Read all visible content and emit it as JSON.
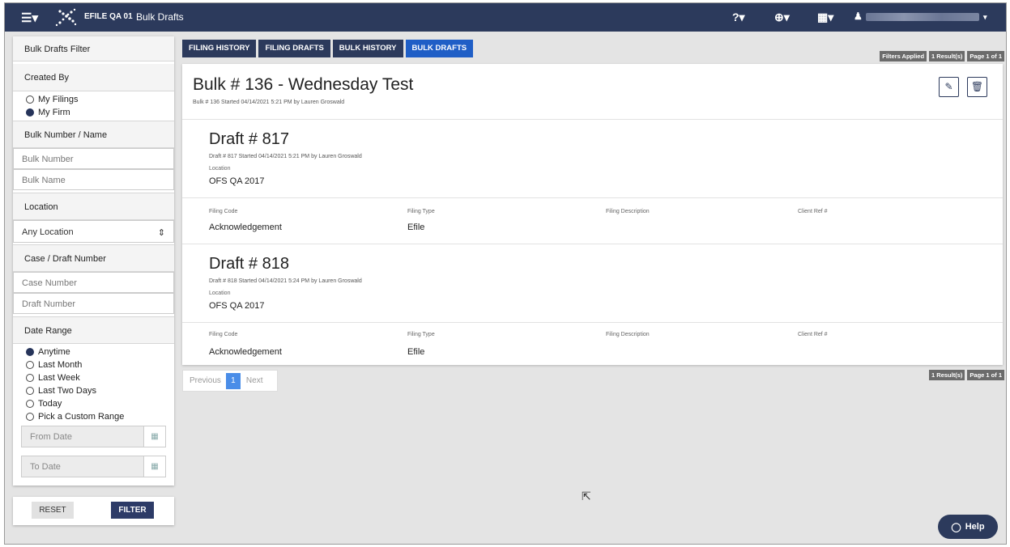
{
  "topbar": {
    "menu_icon": "☰▾",
    "logo": "grid-diamond-logo",
    "app_name": "EFILE QA 01",
    "page_title": "Bulk Drafts",
    "help_icon": "?▾",
    "globe_icon": "⊕▾",
    "apps_icon": "▦▾",
    "user_icon": "👤"
  },
  "sidebar": {
    "title": "Bulk Drafts Filter",
    "created_by": {
      "label": "Created By",
      "options": [
        "My Filings",
        "My Firm"
      ],
      "selected": "My Firm"
    },
    "bulk": {
      "label": "Bulk Number / Name",
      "number_placeholder": "Bulk Number",
      "name_placeholder": "Bulk Name"
    },
    "location": {
      "label": "Location",
      "value": "Any Location"
    },
    "case_draft": {
      "label": "Case / Draft Number",
      "case_placeholder": "Case Number",
      "draft_placeholder": "Draft Number"
    },
    "date_range": {
      "label": "Date Range",
      "options": [
        "Anytime",
        "Last Month",
        "Last Week",
        "Last Two Days",
        "Today",
        "Pick a Custom Range"
      ],
      "selected": "Anytime",
      "from_placeholder": "From Date",
      "to_placeholder": "To Date"
    },
    "reset_label": "RESET",
    "filter_label": "FILTER"
  },
  "tabs": [
    "FILING HISTORY",
    "FILING DRAFTS",
    "BULK HISTORY",
    "BULK DRAFTS"
  ],
  "active_tab": "BULK DRAFTS",
  "badges_top": [
    "Filters Applied",
    "1 Result(s)",
    "Page 1 of 1"
  ],
  "badges_bottom": [
    "1 Result(s)",
    "Page 1 of 1"
  ],
  "bulk": {
    "title": "Bulk # 136 - Wednesday Test",
    "subtitle": "Bulk # 136 Started 04/14/2021 5:21 PM by Lauren Groswald"
  },
  "drafts": [
    {
      "title": "Draft # 817",
      "subtitle": "Draft # 817 Started 04/14/2021 5:21 PM by Lauren Groswald",
      "location_label": "Location",
      "location": "OFS QA 2017",
      "filing_code_label": "Filing Code",
      "filing_code": "Acknowledgement",
      "filing_type_label": "Filing Type",
      "filing_type": "Efile",
      "filing_desc_label": "Filing Description",
      "client_ref_label": "Client Ref #"
    },
    {
      "title": "Draft # 818",
      "subtitle": "Draft # 818 Started 04/14/2021 5:24 PM by Lauren Groswald",
      "location_label": "Location",
      "location": "OFS QA 2017",
      "filing_code_label": "Filing Code",
      "filing_code": "Acknowledgement",
      "filing_type_label": "Filing Type",
      "filing_type": "Efile",
      "filing_desc_label": "Filing Description",
      "client_ref_label": "Client Ref #"
    }
  ],
  "pager": {
    "prev": "Previous",
    "page": "1",
    "next": "Next"
  },
  "help_label": "Help"
}
